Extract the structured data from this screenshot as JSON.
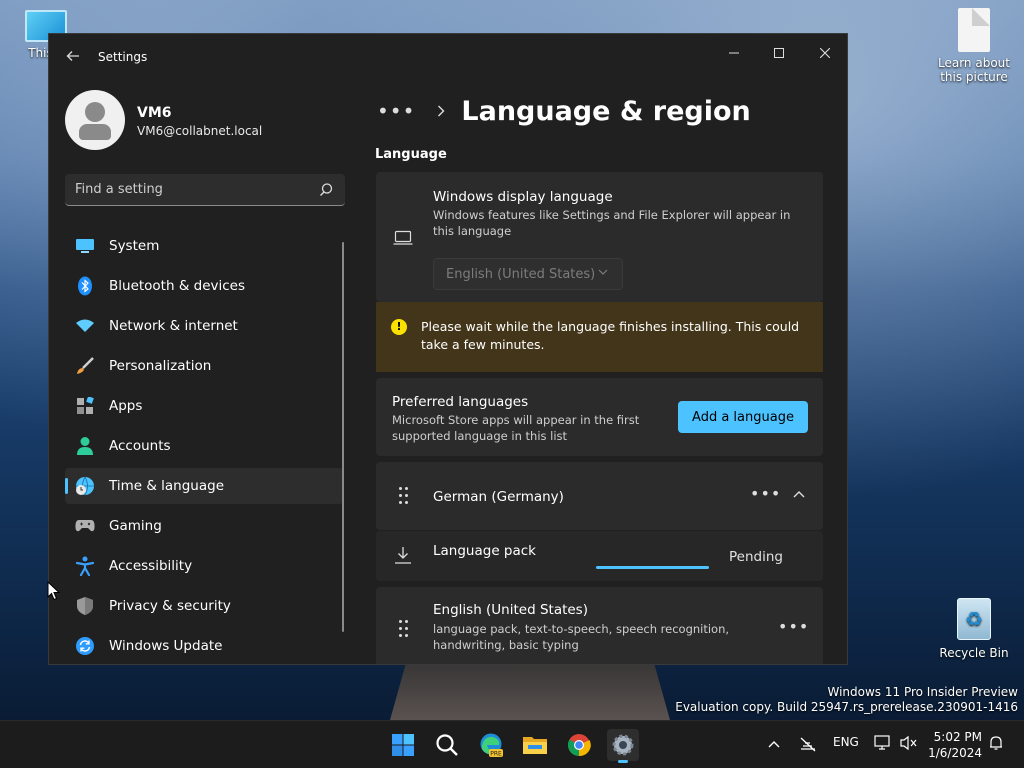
{
  "desktop": {
    "icons": [
      {
        "label": "This P"
      },
      {
        "label": "Learn about this picture"
      },
      {
        "label": "Recycle Bin"
      }
    ],
    "watermark_line1": "Windows 11 Pro Insider Preview",
    "watermark_line2": "Evaluation copy. Build 25947.rs_prerelease.230901-1416"
  },
  "window": {
    "title": "Settings",
    "controls": {
      "minimize": "—",
      "maximize": "□",
      "close": "✕"
    }
  },
  "profile": {
    "name": "VM6",
    "email": "VM6@collabnet.local"
  },
  "search": {
    "placeholder": "Find a setting"
  },
  "nav": {
    "items": [
      {
        "label": "System",
        "icon": "monitor-icon",
        "color": "#4cc2ff"
      },
      {
        "label": "Bluetooth & devices",
        "icon": "bluetooth-icon",
        "color": "#1e90ff"
      },
      {
        "label": "Network & internet",
        "icon": "wifi-icon",
        "color": "#60cdff"
      },
      {
        "label": "Personalization",
        "icon": "brush-icon",
        "color": "#f0a040"
      },
      {
        "label": "Apps",
        "icon": "apps-icon",
        "color": "#b0b0b0"
      },
      {
        "label": "Accounts",
        "icon": "person-icon",
        "color": "#2ecc9a"
      },
      {
        "label": "Time & language",
        "icon": "globe-clock-icon",
        "color": "#4cc2ff",
        "active": true
      },
      {
        "label": "Gaming",
        "icon": "gamepad-icon",
        "color": "#b0b0b0"
      },
      {
        "label": "Accessibility",
        "icon": "accessibility-icon",
        "color": "#3aa0ff"
      },
      {
        "label": "Privacy & security",
        "icon": "shield-icon",
        "color": "#9a9a9a"
      },
      {
        "label": "Windows Update",
        "icon": "update-icon",
        "color": "#2e9bff"
      }
    ]
  },
  "main": {
    "breadcrumb_more": "•••",
    "page_title": "Language & region",
    "section_language": "Language",
    "display_language": {
      "title": "Windows display language",
      "description": "Windows features like Settings and File Explorer will appear in this language",
      "selected": "English (United States)"
    },
    "warning": {
      "text": "Please wait while the language finishes installing. This could take a few minutes."
    },
    "preferred": {
      "title": "Preferred languages",
      "description": "Microsoft Store apps will appear in the first supported language in this list",
      "add_button": "Add a language"
    },
    "german": {
      "label": "German (Germany)",
      "more": "•••"
    },
    "language_pack": {
      "label": "Language pack",
      "status": "Pending",
      "progress": 1.0
    },
    "english": {
      "label": "English (United States)",
      "description": "language pack, text-to-speech, speech recognition, handwriting, basic typing",
      "more": "•••"
    }
  },
  "taskbar": {
    "apps": [
      "start-icon",
      "search-icon",
      "edge-pre-icon",
      "file-explorer-icon",
      "chrome-icon",
      "settings-icon"
    ],
    "tray_lang": "ENG",
    "time": "5:02 PM",
    "date": "1/6/2024"
  }
}
